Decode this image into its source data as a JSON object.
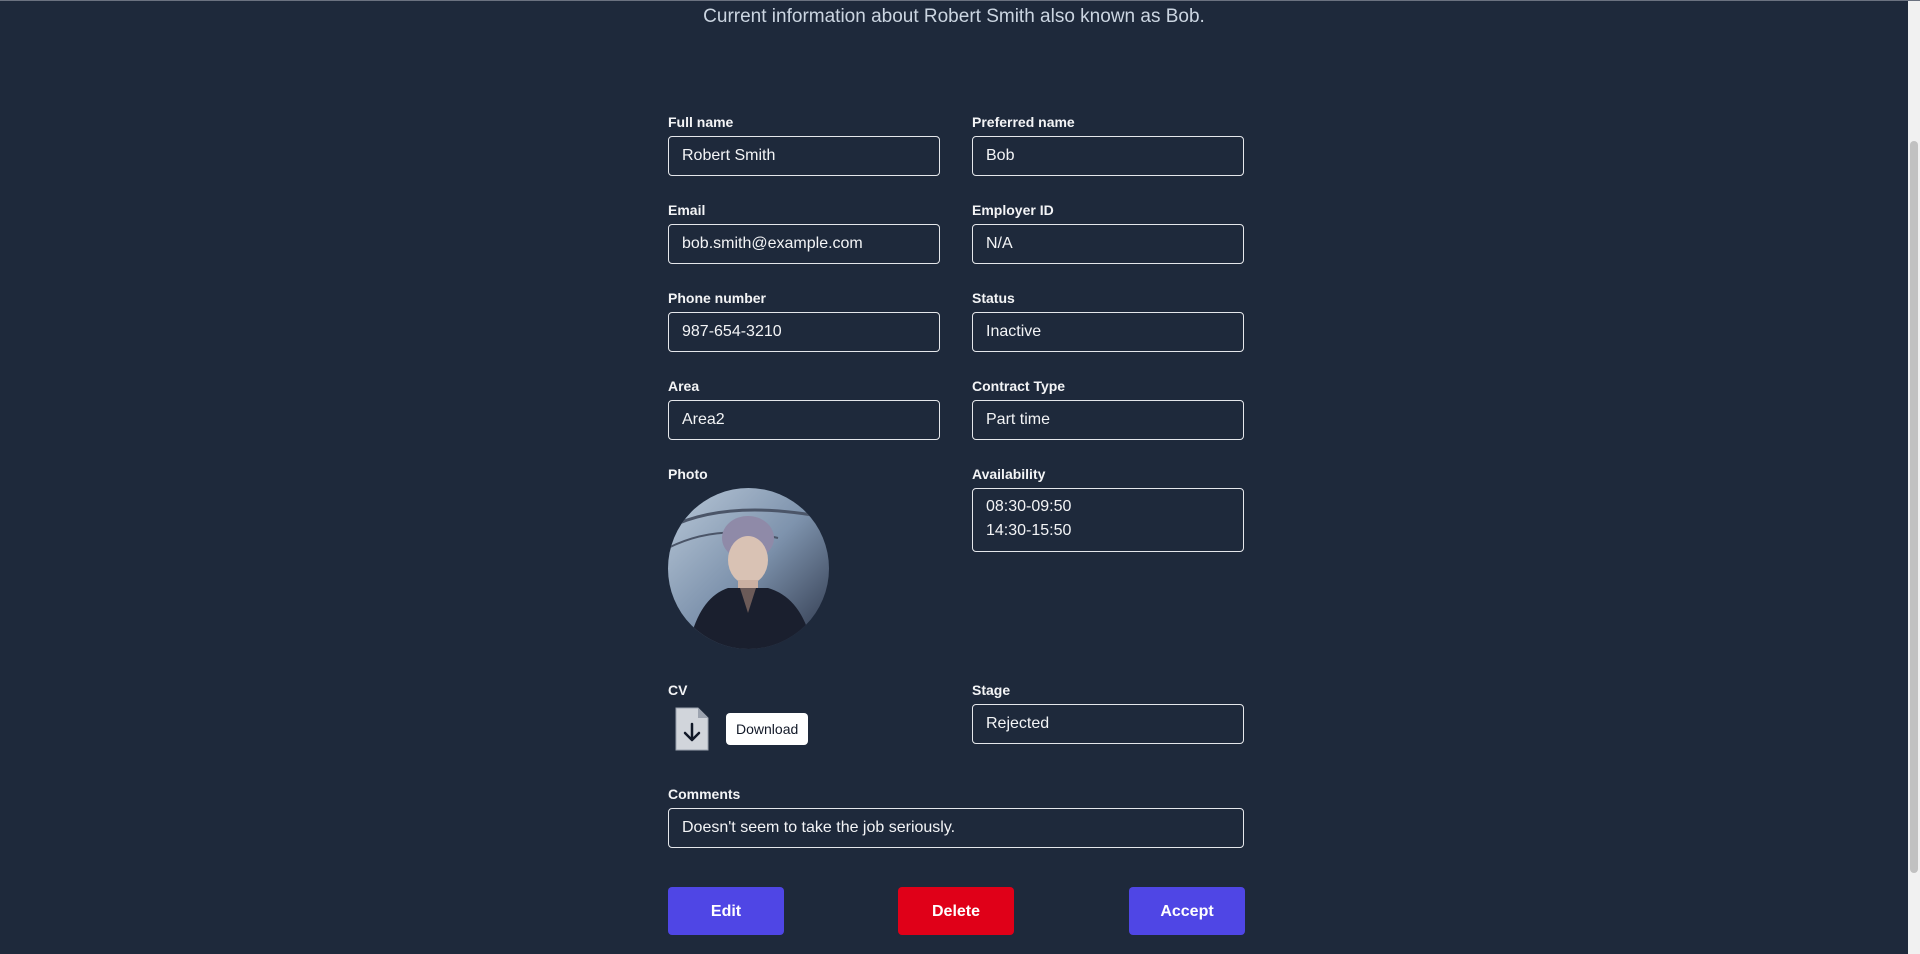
{
  "header": {
    "subtitle": "Current information about Robert Smith also known as Bob."
  },
  "fields": {
    "full_name": {
      "label": "Full name",
      "value": "Robert Smith"
    },
    "preferred_name": {
      "label": "Preferred name",
      "value": "Bob"
    },
    "email": {
      "label": "Email",
      "value": "bob.smith@example.com"
    },
    "employer_id": {
      "label": "Employer ID",
      "value": "N/A"
    },
    "phone": {
      "label": "Phone number",
      "value": "987-654-3210"
    },
    "status": {
      "label": "Status",
      "value": "Inactive"
    },
    "area": {
      "label": "Area",
      "value": "Area2"
    },
    "contract_type": {
      "label": "Contract Type",
      "value": "Part time"
    },
    "photo": {
      "label": "Photo"
    },
    "availability": {
      "label": "Availability",
      "lines": [
        "08:30-09:50",
        "14:30-15:50"
      ]
    },
    "cv": {
      "label": "CV",
      "download_label": "Download",
      "icon": "file-download-icon"
    },
    "stage": {
      "label": "Stage",
      "value": "Rejected"
    },
    "comments": {
      "label": "Comments",
      "value": "Doesn't seem to take the job seriously."
    }
  },
  "actions": {
    "edit": "Edit",
    "delete": "Delete",
    "accept": "Accept"
  },
  "colors": {
    "background": "#1e293b",
    "primary": "#4f46e5",
    "danger": "#e00018"
  }
}
